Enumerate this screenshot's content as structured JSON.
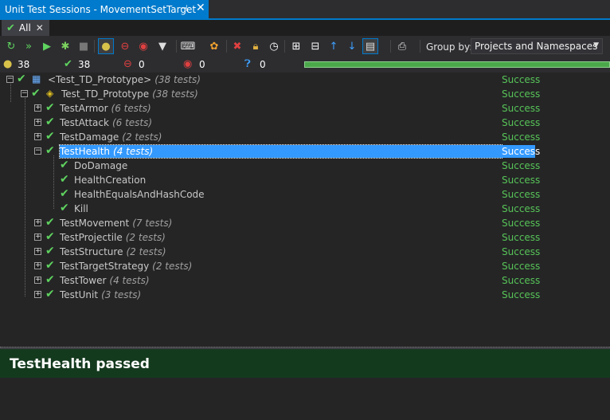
{
  "window": {
    "title": "Unit Test Sessions - MovementSetTarget",
    "pin_icon": "pin-icon",
    "close_icon": "close-icon"
  },
  "session_tab": {
    "label": "All"
  },
  "toolbar": {
    "icons": [
      "run-icon",
      "run-all-icon",
      "play-icon",
      "debug-bug-icon",
      "stop-icon",
      "filter-passed-icon",
      "filter-failed-icon",
      "filter-ignored-icon",
      "filter-funnel-icon",
      "unit-tests-icon",
      "dotcover-icon",
      "remove-icon",
      "lock-icon",
      "clock-icon",
      "expand-all-icon",
      "collapse-all-icon",
      "previous-icon",
      "next-icon",
      "preview-icon",
      "export-icon"
    ],
    "group_by_label": "Group by:",
    "group_by_value": "Projects and Namespaces"
  },
  "stats": {
    "total": "38",
    "passed": "38",
    "failed": "0",
    "ignored": "0",
    "inconclusive": "0",
    "progress_fraction": 1.0
  },
  "tree": [
    {
      "name": "<Test_TD_Prototype>",
      "count": "(38 tests)",
      "status": "Success"
    },
    {
      "name": "Test_TD_Prototype",
      "count": "(38 tests)",
      "status": "Success"
    },
    {
      "name": "TestArmor",
      "count": "(6 tests)",
      "status": "Success"
    },
    {
      "name": "TestAttack",
      "count": "(6 tests)",
      "status": "Success"
    },
    {
      "name": "TestDamage",
      "count": "(2 tests)",
      "status": "Success"
    },
    {
      "name": "TestHealth",
      "count": "(4 tests)",
      "status": "Success"
    },
    {
      "name": "DoDamage",
      "count": "",
      "status": "Success"
    },
    {
      "name": "HealthCreation",
      "count": "",
      "status": "Success"
    },
    {
      "name": "HealthEqualsAndHashCode",
      "count": "",
      "status": "Success"
    },
    {
      "name": "Kill",
      "count": "",
      "status": "Success"
    },
    {
      "name": "TestMovement",
      "count": "(7 tests)",
      "status": "Success"
    },
    {
      "name": "TestProjectile",
      "count": "(2 tests)",
      "status": "Success"
    },
    {
      "name": "TestStructure",
      "count": "(2 tests)",
      "status": "Success"
    },
    {
      "name": "TestTargetStrategy",
      "count": "(2 tests)",
      "status": "Success"
    },
    {
      "name": "TestTower",
      "count": "(4 tests)",
      "status": "Success"
    },
    {
      "name": "TestUnit",
      "count": "(3 tests)",
      "status": "Success"
    }
  ],
  "result": {
    "text": "TestHealth passed"
  },
  "colors": {
    "accent": "#007acc",
    "success": "#57c457",
    "selection": "#3399ff",
    "result_bg": "#143a1e"
  }
}
